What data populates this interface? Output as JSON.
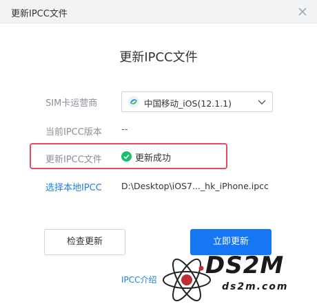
{
  "window": {
    "title": "更新IPCC文件"
  },
  "heading": "更新IPCC文件",
  "form": {
    "carrier_label": "SIM卡运营商",
    "carrier_value": "中国移动_iOS(12.1.1)",
    "carrier_icon": "china-mobile-logo-icon",
    "version_label": "当前IPCC版本",
    "version_value": "--",
    "file_label": "更新IPCC文件",
    "file_status": "更新成功",
    "file_status_icon": "check-circle-icon",
    "local_link": "选择本地IPCC",
    "local_path": "D:\\Desktop\\iOS7..._hk_iPhone.ipcc"
  },
  "buttons": {
    "check_update": "检查更新",
    "update_now": "立即更新"
  },
  "footer": {
    "ipcc_intro": "IPCC介绍"
  },
  "watermark": {
    "brand": "DS2M",
    "domain": "ds2m.com"
  },
  "colors": {
    "accent": "#1677f5",
    "link": "#1e7fe0",
    "success": "#19be6b",
    "highlight": "#e84c61"
  }
}
